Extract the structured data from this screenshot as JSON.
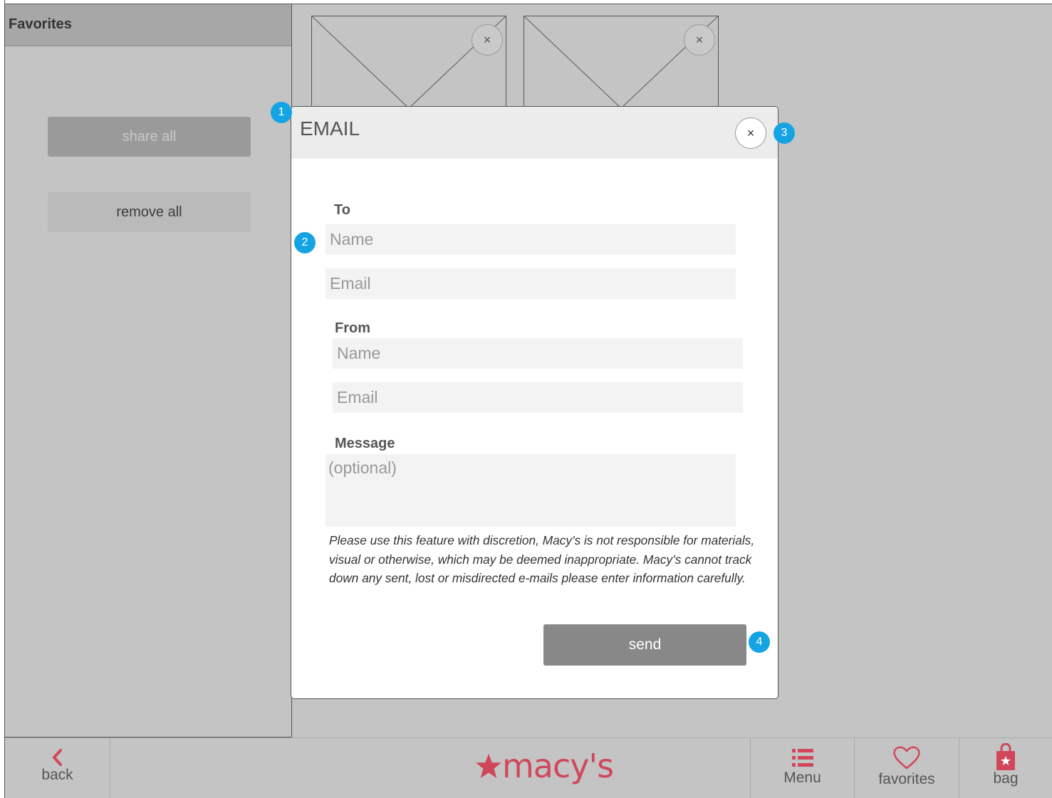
{
  "panel": {
    "title": "Favorites",
    "share_all_label": "share all",
    "remove_all_label": "remove all"
  },
  "tiles": [
    {
      "close_glyph": "×"
    },
    {
      "close_glyph": "×"
    }
  ],
  "modal": {
    "title": "EMAIL",
    "close_glyph": "×",
    "to_label": "To",
    "to_name_placeholder": "Name",
    "to_email_placeholder": "Email",
    "from_label": "From",
    "from_name_placeholder": "Name",
    "from_email_placeholder": "Email",
    "message_label": "Message",
    "message_placeholder": "(optional)",
    "disclaimer": "Please use this feature with discretion, Macy’s is not responsible for materials, visual or otherwise, which may be deemed inappropriate. Macy’s cannot track down any sent, lost or misdirected e-mails please enter information carefully.",
    "send_label": "send"
  },
  "badges": {
    "b1": "1",
    "b2": "2",
    "b3": "3",
    "b4": "4"
  },
  "nav": {
    "back_label": "back",
    "logo_text": "macy's",
    "menu_label": "Menu",
    "favorites_label": "favorites",
    "bag_label": "bag"
  },
  "colors": {
    "brand_red": "#d0475b",
    "badge_blue": "#14a4e4",
    "send_gray": "#888888"
  },
  "icons": {
    "back": "chevron-left-icon",
    "menu": "list-icon",
    "favorites": "heart-icon",
    "bag": "shopping-bag-icon",
    "close": "close-icon"
  }
}
